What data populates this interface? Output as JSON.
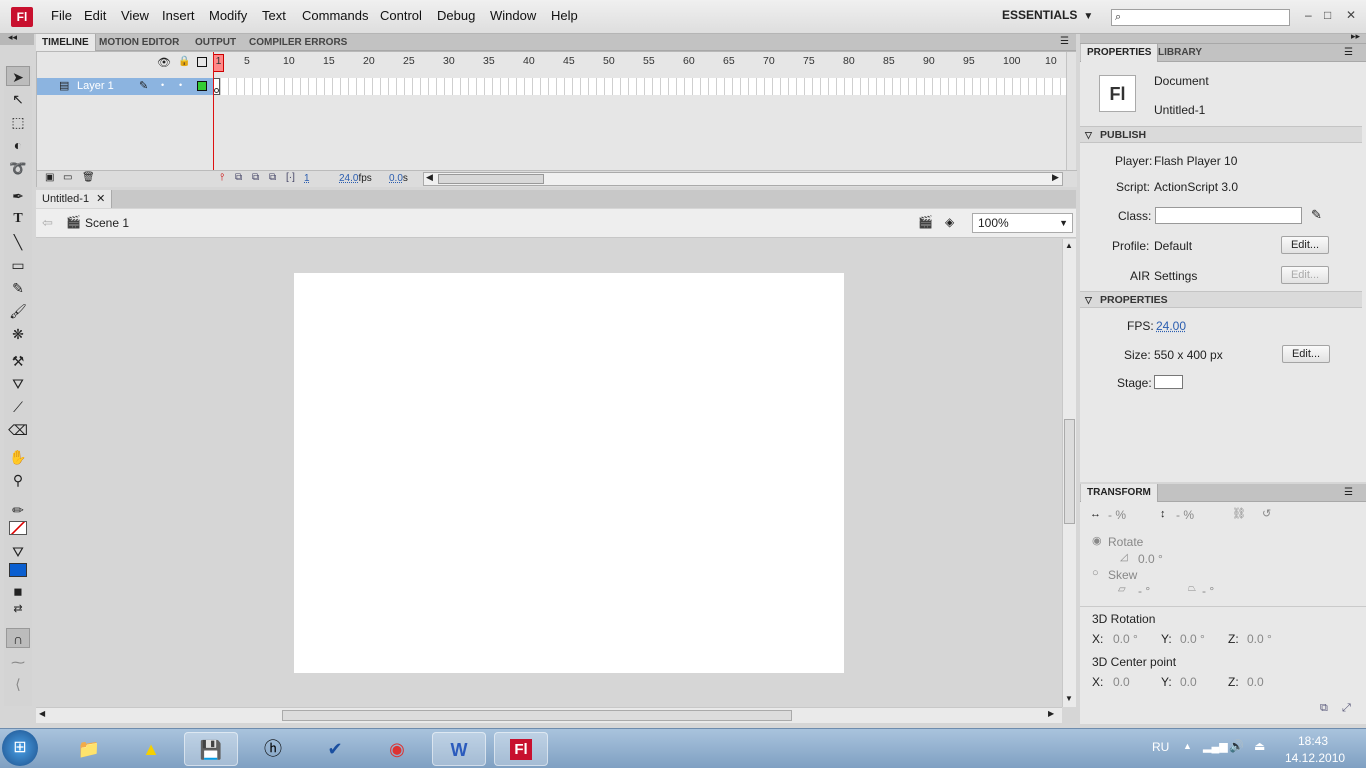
{
  "app": {
    "logo": "Fl"
  },
  "menu": [
    "File",
    "Edit",
    "View",
    "Insert",
    "Modify",
    "Text",
    "Commands",
    "Control",
    "Debug",
    "Window",
    "Help"
  ],
  "workspace": "ESSENTIALS",
  "window_controls": [
    "–",
    "□",
    "✕"
  ],
  "timeline_tabs": [
    "TIMELINE",
    "MOTION EDITOR",
    "OUTPUT",
    "COMPILER ERRORS"
  ],
  "ruler": [
    "1",
    "5",
    "10",
    "15",
    "20",
    "25",
    "30",
    "35",
    "40",
    "45",
    "50",
    "55",
    "60",
    "65",
    "70",
    "75",
    "80",
    "85",
    "90",
    "95",
    "100",
    "10"
  ],
  "layer": {
    "name": "Layer 1"
  },
  "timeline_footer": {
    "frame": "1",
    "fps": "24.0",
    "fps_unit": "fps",
    "time": "0.0",
    "time_unit": "s"
  },
  "document": {
    "tab": "Untitled-1",
    "close": "✕",
    "scene": "Scene 1",
    "zoom": "100%"
  },
  "stage_fill": "#ffffff",
  "right_tabs": [
    "PROPERTIES",
    "LIBRARY"
  ],
  "props": {
    "doc_icon": "Fl",
    "doc_type": "Document",
    "doc_name": "Untitled-1",
    "publish_head": "PUBLISH",
    "player_label": "Player:",
    "player_value": "Flash Player 10",
    "script_label": "Script:",
    "script_value": "ActionScript 3.0",
    "class_label": "Class:",
    "profile_label": "Profile:",
    "profile_value": "Default",
    "edit_label": "Edit...",
    "air_label": "AIR",
    "air_value": "Settings",
    "properties_head": "PROPERTIES",
    "fps_label": "FPS:",
    "fps_value": "24.00",
    "size_label": "Size:",
    "size_value": "550 x 400 px",
    "stage_label": "Stage:"
  },
  "transform": {
    "tab": "TRANSFORM",
    "width_pct": "- %",
    "height_pct": "- %",
    "rotate_label": "Rotate",
    "rotate_value": "0.0 °",
    "skew_label": "Skew",
    "skew_h": "- °",
    "skew_v": "- °",
    "rot3d_label": "3D Rotation",
    "rot_x": "0.0 °",
    "rot_y": "0.0 °",
    "rot_z": "0.0 °",
    "center_label": "3D Center point",
    "c_x": "0.0",
    "c_y": "0.0",
    "c_z": "0.0",
    "x": "X:",
    "y": "Y:",
    "z": "Z:"
  },
  "taskbar": {
    "lang": "RU",
    "time": "18:43",
    "date": "14.12.2010"
  }
}
